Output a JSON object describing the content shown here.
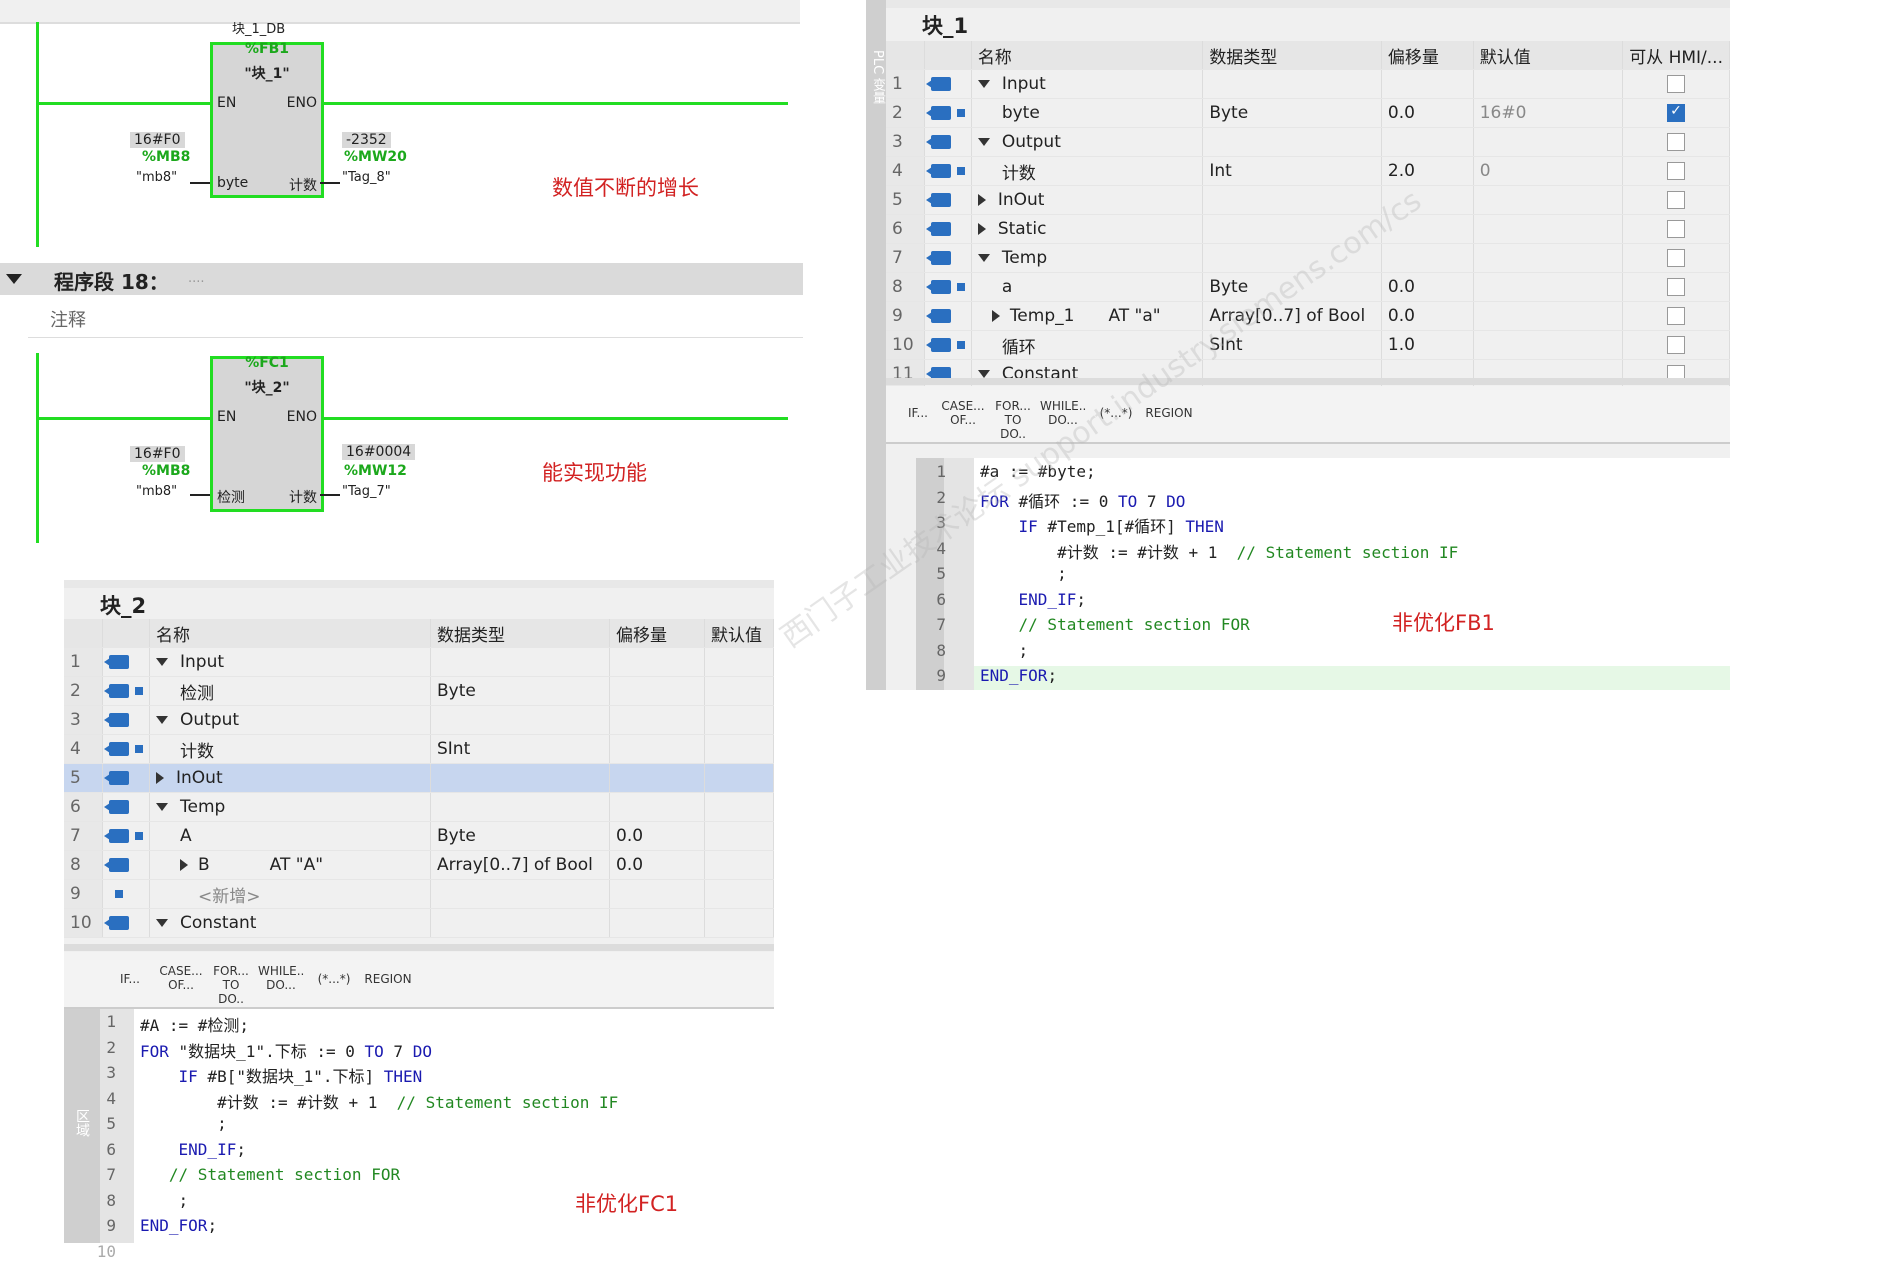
{
  "ladder": {
    "net1": {
      "db_label": "块_1_DB",
      "block_addr": "%FB1",
      "block_name": "\"块_1\"",
      "en": "EN",
      "eno": "ENO",
      "in_pin": "byte",
      "out_pin": "计数",
      "in_value": "16#F0",
      "in_addr": "%MB8",
      "in_tag": "\"mb8\"",
      "out_value": "-2352",
      "out_addr": "%MW20",
      "out_tag": "\"Tag_8\"",
      "note": "数值不断的增长"
    },
    "segment": {
      "title": "程序段 18：",
      "dots": "....",
      "comment": "注释"
    },
    "net2": {
      "block_addr": "%FC1",
      "block_name": "\"块_2\"",
      "en": "EN",
      "eno": "ENO",
      "in_pin": "检测",
      "out_pin": "计数",
      "in_value": "16#F0",
      "in_addr": "%MB8",
      "in_tag": "\"mb8\"",
      "out_value": "16#0004",
      "out_addr": "%MW12",
      "out_tag": "\"Tag_7\"",
      "note": "能实现功能"
    }
  },
  "fb1": {
    "title": "块_1",
    "headers": [
      "名称",
      "数据类型",
      "偏移量",
      "默认值",
      "可从 HMI/..."
    ],
    "rows": [
      {
        "n": "1",
        "name": "Input",
        "type": "",
        "offset": "",
        "def": "",
        "hmi": false
      },
      {
        "n": "2",
        "name": "byte",
        "type": "Byte",
        "offset": "0.0",
        "def": "16#0",
        "hmi": true
      },
      {
        "n": "3",
        "name": "Output",
        "type": "",
        "offset": "",
        "def": "",
        "hmi": false
      },
      {
        "n": "4",
        "name": "计数",
        "type": "Int",
        "offset": "2.0",
        "def": "0",
        "hmi": false
      },
      {
        "n": "5",
        "name": "InOut",
        "type": "",
        "offset": "",
        "def": "",
        "hmi": false
      },
      {
        "n": "6",
        "name": "Static",
        "type": "",
        "offset": "",
        "def": "",
        "hmi": false
      },
      {
        "n": "7",
        "name": "Temp",
        "type": "",
        "offset": "",
        "def": "",
        "hmi": false
      },
      {
        "n": "8",
        "name": "a",
        "type": "Byte",
        "offset": "0.0",
        "def": "",
        "hmi": false
      },
      {
        "n": "9",
        "name": "Temp_1",
        "at": "AT \"a\"",
        "type": "Array[0..7] of Bool",
        "offset": "0.0",
        "def": "",
        "hmi": false
      },
      {
        "n": "10",
        "name": "循环",
        "type": "SInt",
        "offset": "1.0",
        "def": "",
        "hmi": false
      },
      {
        "n": "11",
        "name": "Constant",
        "type": "",
        "offset": "",
        "def": "",
        "hmi": false
      }
    ],
    "toolbar": [
      "IF...",
      "CASE... OF...",
      "FOR... TO DO..",
      "WHILE.. DO...",
      "(*...*)",
      "REGION"
    ],
    "code": [
      "#a := #byte;",
      "FOR #循环 := 0 TO 7 DO",
      "    IF #Temp_1[#循环] THEN",
      "        #计数 := #计数 + 1  // Statement section IF",
      "        ;",
      "    END_IF;",
      "    // Statement section FOR",
      "    ;",
      "END_FOR;"
    ],
    "note": "非优化FB1",
    "side_label": "PLC 变量"
  },
  "fc1": {
    "title": "块_2",
    "headers": [
      "名称",
      "数据类型",
      "偏移量",
      "默认值"
    ],
    "rows": [
      {
        "n": "1",
        "name": "Input",
        "type": "",
        "offset": ""
      },
      {
        "n": "2",
        "name": "检测",
        "type": "Byte",
        "offset": ""
      },
      {
        "n": "3",
        "name": "Output",
        "type": "",
        "offset": ""
      },
      {
        "n": "4",
        "name": "计数",
        "type": "SInt",
        "offset": ""
      },
      {
        "n": "5",
        "name": "InOut",
        "type": "",
        "offset": ""
      },
      {
        "n": "6",
        "name": "Temp",
        "type": "",
        "offset": ""
      },
      {
        "n": "7",
        "name": "A",
        "type": "Byte",
        "offset": "0.0"
      },
      {
        "n": "8",
        "name": "B",
        "at": "AT \"A\"",
        "type": "Array[0..7] of Bool",
        "offset": "0.0"
      },
      {
        "n": "9",
        "name": "<新增>",
        "type": "",
        "offset": ""
      },
      {
        "n": "10",
        "name": "Constant",
        "type": "",
        "offset": ""
      }
    ],
    "toolbar": [
      "IF...",
      "CASE... OF...",
      "FOR... TO DO..",
      "WHILE.. DO...",
      "(*...*)",
      "REGION"
    ],
    "code": [
      "#A := #检测;",
      "FOR \"数据块_1\".下标 := 0 TO 7 DO",
      "    IF #B[\"数据块_1\".下标] THEN",
      "        #计数 := #计数 + 1  // Statement section IF",
      "        ;",
      "    END_IF;",
      "   // Statement section FOR",
      "    ;",
      "END_FOR;"
    ],
    "line10": "10",
    "note": "非优化FC1",
    "side_label": "区域"
  },
  "watermark": "西门子工业技术论坛 support.industry.siemens.com/cs"
}
